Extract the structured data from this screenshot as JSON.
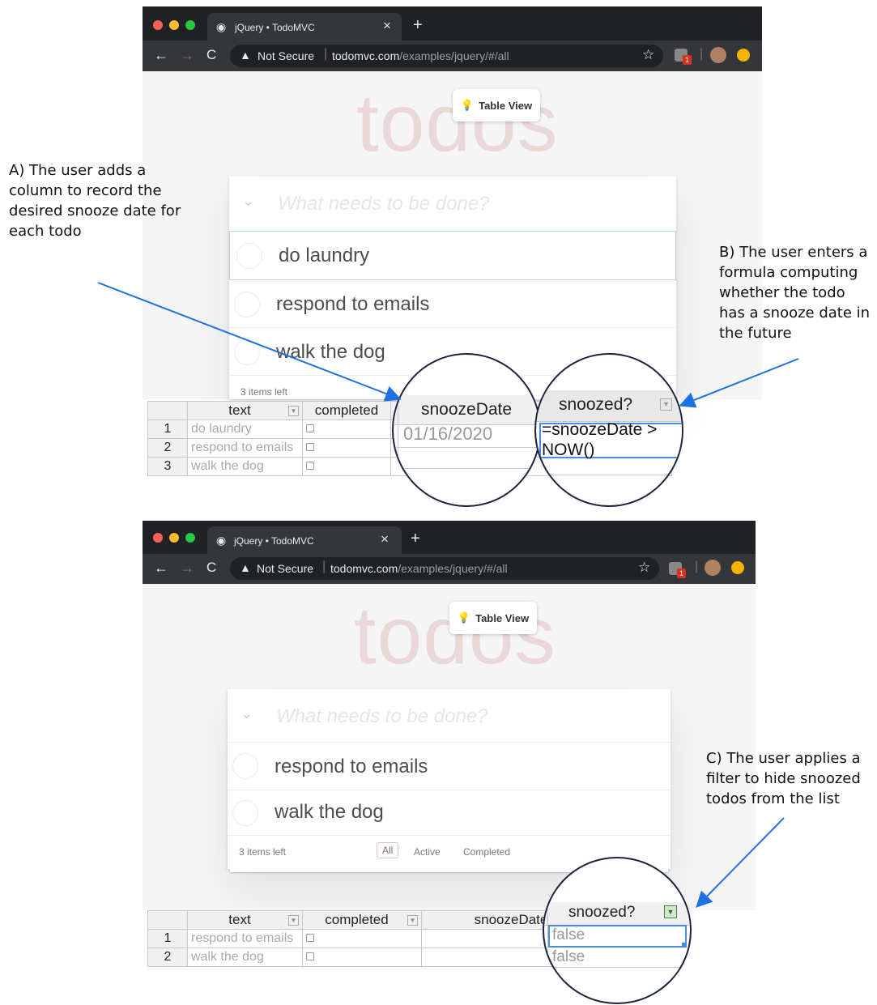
{
  "browser": {
    "tab_title": "jQuery • TodoMVC",
    "tab_close": "×",
    "new_tab": "+",
    "security": "Not Secure",
    "url_host": "todomvc.com",
    "url_path": "/examples/jquery/#/all",
    "badge_count": "1"
  },
  "app": {
    "title": "todos",
    "table_view_button": "Table View",
    "new_todo_placeholder": "What needs to be done?",
    "items_left": "3 items left",
    "filter_all": "All",
    "filter_active": "Active",
    "filter_completed": "Completed"
  },
  "top": {
    "todos": [
      "do laundry",
      "respond to emails",
      "walk the dog"
    ],
    "footer_active_fragment": "ve",
    "grid": {
      "headers": [
        "text",
        "completed",
        "snoozeDate",
        "snoozed?"
      ],
      "rows": [
        {
          "n": "1",
          "text": "do laundry",
          "snoozeDate": "01/16/2020"
        },
        {
          "n": "2",
          "text": "respond to emails",
          "snoozeDate": ""
        },
        {
          "n": "3",
          "text": "walk the dog",
          "snoozeDate": ""
        }
      ],
      "formula": "=snoozeDate > NOW()"
    }
  },
  "bottom": {
    "todos": [
      "respond to emails",
      "walk the dog"
    ],
    "grid": {
      "headers": [
        "text",
        "completed",
        "snoozeDate",
        "snoozed?"
      ],
      "rows": [
        {
          "n": "1",
          "text": "respond to emails",
          "snoozed": "false"
        },
        {
          "n": "2",
          "text": "walk the dog",
          "snoozed": "false"
        }
      ]
    }
  },
  "annotations": {
    "a": "A) The user adds a column to record the desired snooze date for each todo",
    "b": "B) The user enters a formula computing whether the todo has a snooze date in the future",
    "c": "C) The user applies a filter to hide snoozed todos from the list"
  },
  "colors": {
    "arrow": "#1f6fe5",
    "chrome": "#202124",
    "selection": "#4a8cdc",
    "todos_title": "#e6c9c9"
  }
}
